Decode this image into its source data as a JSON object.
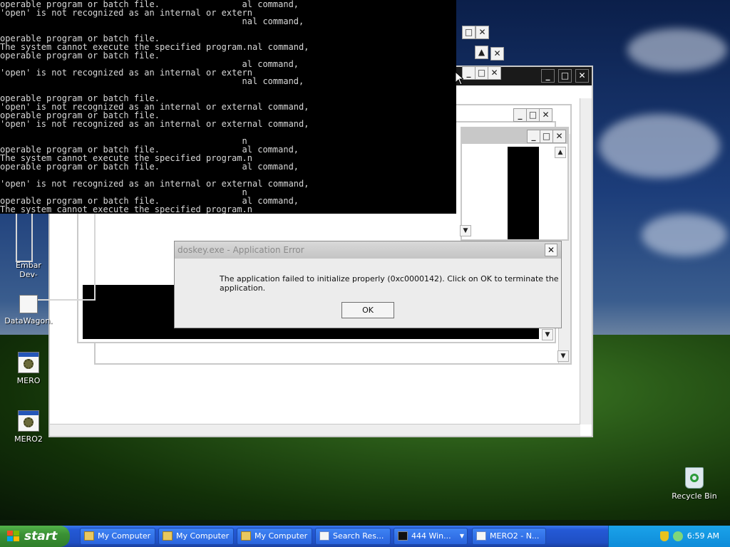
{
  "console": {
    "lines": [
      "operable program or batch file.                al command,",
      "'open' is not recognized as an internal or extern",
      "                                               nal command,",
      "",
      "operable program or batch file.",
      "The system cannot execute the specified program.nal command,",
      "operable program or batch file.",
      "                                               al command,",
      "'open' is not recognized as an internal or extern",
      "                                               nal command,",
      "",
      "operable program or batch file.",
      "'open' is not recognized as an internal or external command,",
      "operable program or batch file.",
      "'open' is not recognized as an internal or external command,",
      "",
      "                                               n",
      "operable program or batch file.                al command,",
      "The system cannot execute the specified program.n",
      "operable program or batch file.                al command,",
      "",
      "'open' is not recognized as an internal or external command,",
      "                                               n",
      "operable program or batch file.                al command,",
      "The system cannot execute the specified program.n",
      "operable program or batch file.                al command,"
    ]
  },
  "dialog": {
    "title": "doskey.exe - Application Error",
    "message": "The application failed to initialize properly (0xc0000142). Click on OK to terminate the application.",
    "ok_label": "OK",
    "close_glyph": "✕"
  },
  "desktop_icons": [
    {
      "name": "embar-icon",
      "label_line1": "Embar",
      "label_line2": "Dev-"
    },
    {
      "name": "datawagon-icon",
      "label": "DataWagon."
    },
    {
      "name": "mero-icon",
      "label": "MERO"
    },
    {
      "name": "mero2-icon",
      "label": "MERO2"
    },
    {
      "name": "recycle-bin-icon",
      "label": "Recycle Bin"
    }
  ],
  "taskbar": {
    "start_label": "start",
    "items": [
      {
        "label": "My Computer",
        "icon": "folder-icon"
      },
      {
        "label": "My Computer",
        "icon": "folder-icon"
      },
      {
        "label": "My Computer",
        "icon": "folder-icon"
      },
      {
        "label": "Search Res...",
        "icon": "search-results-icon"
      },
      {
        "label": "444 Win...",
        "icon": "cmd-icon"
      },
      {
        "label": "MERO2 - N...",
        "icon": "notepad-icon"
      }
    ],
    "clock": "6:59 AM"
  },
  "glyphs": {
    "min": "_",
    "max": "□",
    "close": "✕",
    "up": "▲",
    "down": "▼",
    "left": "◄",
    "right": "►"
  },
  "colors": {
    "taskbar": "#245edb",
    "start": "#3c9a36",
    "console_bg": "#000000",
    "dialog_bg": "#ececec"
  }
}
